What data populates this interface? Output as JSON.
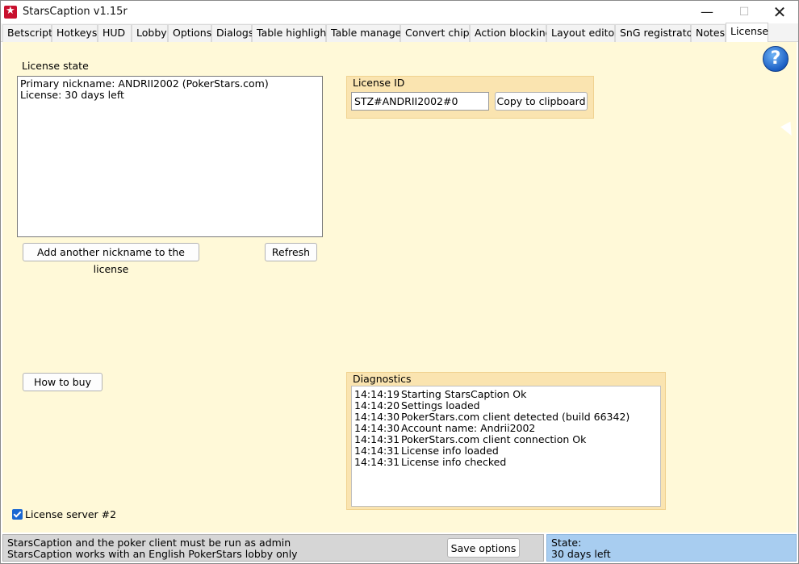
{
  "window": {
    "title": "StarsCaption v1.15r",
    "min_icon": "—",
    "max_icon": "☐",
    "close_icon": "✕"
  },
  "tabs": [
    {
      "label": "Betscript"
    },
    {
      "label": "Hotkeys"
    },
    {
      "label": "HUD"
    },
    {
      "label": "Lobby"
    },
    {
      "label": "Options"
    },
    {
      "label": "Dialogs"
    },
    {
      "label": "Table highlight"
    },
    {
      "label": "Table manager"
    },
    {
      "label": "Convert chips"
    },
    {
      "label": "Action blocking"
    },
    {
      "label": "Layout editor"
    },
    {
      "label": "SnG registrator"
    },
    {
      "label": "Notes"
    },
    {
      "label": "License"
    }
  ],
  "active_tab": "License",
  "license_state": {
    "label": "License state",
    "lines": [
      "Primary nickname: ANDRII2002 (PokerStars.com)",
      "License: 30 days left"
    ],
    "add_nickname_button": "Add another nickname to the license",
    "refresh_button": "Refresh"
  },
  "license_id": {
    "title": "License ID",
    "value": "STZ#ANDRII2002#0",
    "copy_button": "Copy to clipboard"
  },
  "help_icon": "?",
  "how_to_buy_button": "How to buy",
  "diagnostics": {
    "title": "Diagnostics",
    "entries": [
      {
        "time": "14:14:19",
        "text": "Starting StarsCaption Ok"
      },
      {
        "time": "14:14:20",
        "text": "Settings loaded"
      },
      {
        "time": "14:14:30",
        "text": "PokerStars.com client detected (build 66342)"
      },
      {
        "time": "14:14:30",
        "text": "Account name: Andrii2002"
      },
      {
        "time": "14:14:31",
        "text": "PokerStars.com client connection Ok"
      },
      {
        "time": "14:14:31",
        "text": "License info loaded"
      },
      {
        "time": "14:14:31",
        "text": "License info checked"
      }
    ]
  },
  "license_server": {
    "label": "License server #2",
    "checked": true
  },
  "status": {
    "messages": [
      "StarsCaption and the poker client must be run as admin",
      "StarsCaption works with an English PokerStars lobby only"
    ],
    "save_button": "Save options",
    "state_label": "State:",
    "state_value": "30 days left"
  },
  "colors": {
    "content_bg": "#fff9d8",
    "group_bg": "#fae4b0",
    "state_bg": "#a8cdf0",
    "checkbox": "#1967d2"
  }
}
